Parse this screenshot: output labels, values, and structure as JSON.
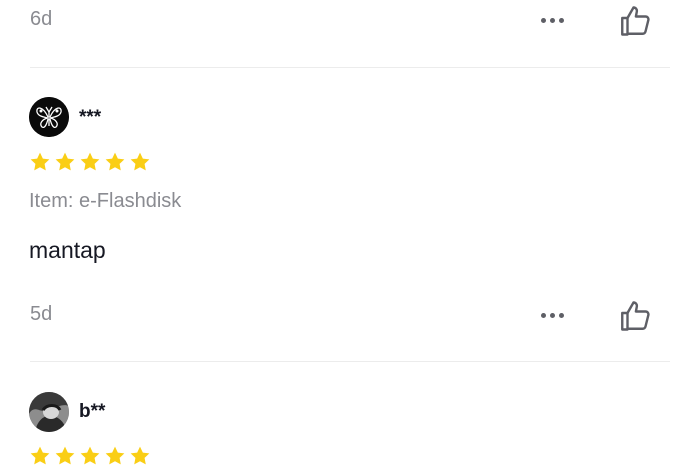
{
  "reviews": [
    {
      "time": "6d",
      "more_icon": "more-horizontal-icon",
      "like_icon": "thumbs-up-icon"
    },
    {
      "user": "***",
      "avatar_icon": "butterfly-avatar",
      "rating": 5,
      "item_label": "Item: e-Flashdisk",
      "comment": "mantap",
      "time": "5d",
      "more_icon": "more-horizontal-icon",
      "like_icon": "thumbs-up-icon"
    },
    {
      "user": "b**",
      "avatar_icon": "photo-avatar",
      "rating": 5
    }
  ],
  "colors": {
    "star": "#FACE15",
    "muted_text": "#8A8B91",
    "text": "#161823",
    "divider": "#ECECEC"
  }
}
